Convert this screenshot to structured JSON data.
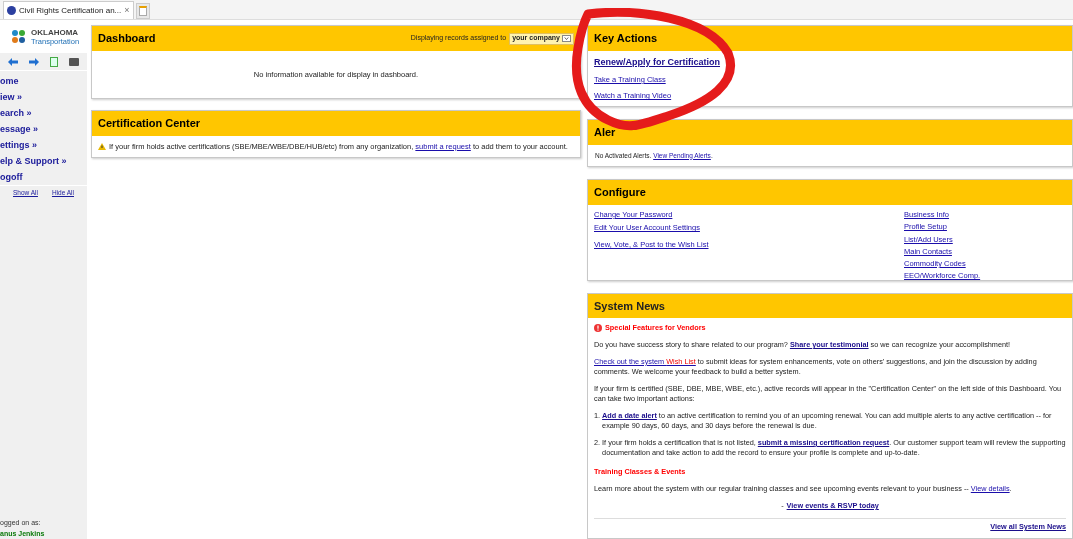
{
  "browser_tab": {
    "title": "Civil Rights Certification an...",
    "close": "×"
  },
  "sidebar": {
    "logo": {
      "line1": "OKLAHOMA",
      "line2": "Transportation"
    },
    "nav": [
      {
        "label": "ome"
      },
      {
        "label": "iew »"
      },
      {
        "label": "earch »"
      },
      {
        "label": "essage »"
      },
      {
        "label": "ettings »"
      },
      {
        "label": "elp & Support »"
      },
      {
        "label": "ogoff"
      }
    ],
    "show_all": "Show All",
    "hide_all": "Hide All",
    "logged_on_label": "ogged on as:",
    "user_name": "anus Jenkins"
  },
  "dashboard": {
    "title": "Dashboard",
    "filter_label": "Displaying records assigned to",
    "filter_value": "your company",
    "message": "No information available for display in dashboard."
  },
  "certification_center": {
    "title": "Certification Center",
    "parts": [
      {
        "kind": "text",
        "text": "If your firm holds active certifications (SBE/MBE/WBE/DBE/HUB/etc) from any organization, "
      },
      {
        "kind": "link",
        "text": "submit a request"
      },
      {
        "kind": "text",
        "text": " to add them to your account."
      }
    ]
  },
  "key_actions": {
    "title": "Key Actions",
    "links": [
      {
        "kind": "primary",
        "label": "Renew/Apply for Certification"
      },
      {
        "kind": "normal",
        "label": "Take a Training Class"
      },
      {
        "kind": "normal",
        "label": "Watch a Training Video"
      }
    ]
  },
  "alerts": {
    "title": "Aler",
    "parts": [
      {
        "kind": "text",
        "text": "No Activated Alerts. "
      },
      {
        "kind": "link",
        "text": "View Pending Alerts"
      },
      {
        "kind": "text",
        "text": "."
      }
    ]
  },
  "configure": {
    "title": "Configure",
    "left_links": [
      "Change Your Password",
      "Edit Your User Account Settings",
      "View, Vote, & Post to the Wish List"
    ],
    "right_links": [
      "Business Info",
      "Profile Setup",
      "List/Add Users",
      "Main Contacts",
      "Commodity Codes",
      "EEO/Workforce Comp."
    ]
  },
  "system_news": {
    "title": "System News",
    "heading": "Special Features for Vendors",
    "paragraphs": [
      {
        "parts": [
          {
            "kind": "text",
            "text": "Do you have success story to share related to our program? "
          },
          {
            "kind": "bold_link",
            "text": "Share your testimonial"
          },
          {
            "kind": "text",
            "text": " so we can recognize your accomplishment!"
          }
        ]
      },
      {
        "parts": [
          {
            "kind": "link",
            "text": "Check out the system ",
            "accent": "Wish List"
          },
          {
            "kind": "text",
            "text": " to submit ideas for system enhancements, vote on others' suggestions, and join the discussion by adding comments. We welcome your feedback to build a better system."
          }
        ]
      },
      {
        "parts": [
          {
            "kind": "text",
            "text": "If your firm is certified (SBE, DBE, MBE, WBE, etc.), active records will appear in the \"Certification Center\" on the left side of this Dashboard. You can take two important actions:"
          }
        ]
      }
    ],
    "actions": [
      {
        "marker": "1.",
        "parts": [
          {
            "kind": "bold_link",
            "text": "Add a date alert"
          },
          {
            "kind": "text",
            "text": " to an active certification to remind you of an upcoming renewal. You can add multiple alerts to any active certification -- for example 90 days, 60 days, and 30 days before the renewal is due."
          }
        ]
      },
      {
        "marker": "2.",
        "parts": [
          {
            "kind": "text",
            "text": "If your firm holds a certification that is not listed, "
          },
          {
            "kind": "bold_link",
            "text": "submit a missing certification request"
          },
          {
            "kind": "text",
            "text": ". Our customer support team will review the supporting documentation and take action to add the record to ensure your profile is complete and up-to-date."
          }
        ]
      }
    ],
    "training_heading": "Training Classes & Events",
    "training_text": [
      {
        "kind": "text",
        "text": "Learn more about the system with our regular training classes and see upcoming events relevant to your business -- "
      },
      {
        "kind": "link",
        "text": "View details"
      },
      {
        "kind": "text",
        "text": "."
      }
    ],
    "rsvp_prefix": "-",
    "rsvp_link": "View events & RSVP today",
    "all_news": "View all System News"
  }
}
